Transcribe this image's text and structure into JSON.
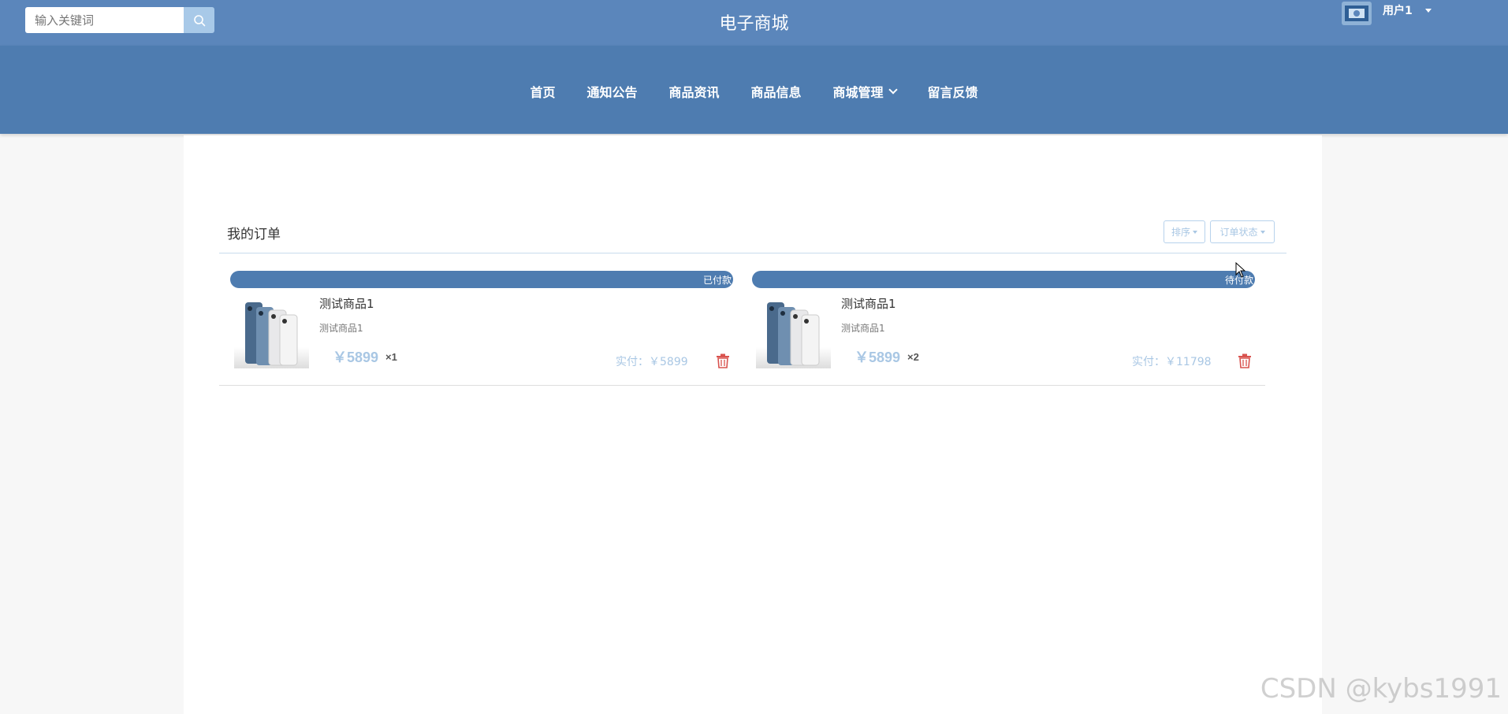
{
  "header": {
    "search": {
      "placeholder": "输入关键词",
      "value": ""
    },
    "site_title": "电子商城",
    "user": {
      "name": "用户1"
    }
  },
  "nav": {
    "items": [
      {
        "label": "首页"
      },
      {
        "label": "通知公告"
      },
      {
        "label": "商品资讯"
      },
      {
        "label": "商品信息"
      },
      {
        "label": "商城管理",
        "has_dropdown": true
      },
      {
        "label": "留言反馈"
      }
    ]
  },
  "orders": {
    "title": "我的订单",
    "filters": {
      "sort_label": "排序",
      "status_label": "订单状态"
    },
    "list": [
      {
        "status": "已付款",
        "name": "测试商品1",
        "subtitle": "测试商品1",
        "price": "￥5899",
        "qty": "×1",
        "paid": "实付：￥5899"
      },
      {
        "status": "待付款",
        "name": "测试商品1",
        "subtitle": "测试商品1",
        "price": "￥5899",
        "qty": "×2",
        "paid": "实付：￥11798"
      }
    ]
  },
  "watermark": "CSDN @kybs1991",
  "colors": {
    "topbar": "#5b86bb",
    "navbar": "#4e7cb0",
    "accent_light": "#a9c7e4",
    "delete": "#d9534f"
  }
}
